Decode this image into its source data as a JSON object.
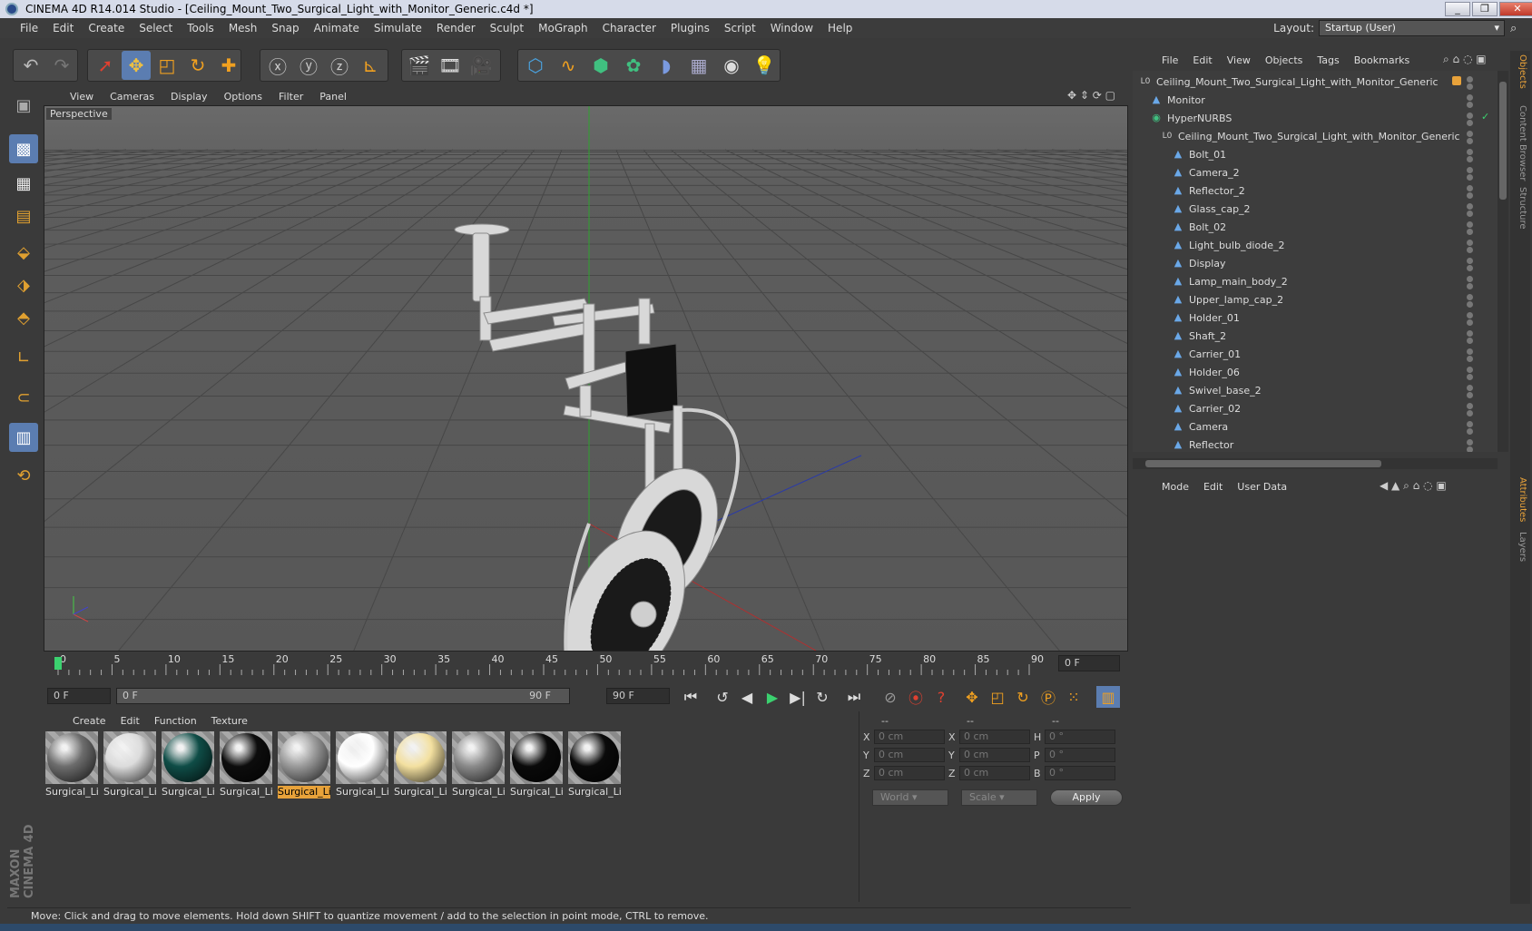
{
  "window": {
    "title": "CINEMA 4D R14.014 Studio - [Ceiling_Mount_Two_Surgical_Light_with_Monitor_Generic.c4d *]"
  },
  "menubar": [
    "File",
    "Edit",
    "Create",
    "Select",
    "Tools",
    "Mesh",
    "Snap",
    "Animate",
    "Simulate",
    "Render",
    "Sculpt",
    "MoGraph",
    "Character",
    "Plugins",
    "Script",
    "Window",
    "Help"
  ],
  "layout": {
    "label": "Layout:",
    "value": "Startup (User)"
  },
  "viewport": {
    "menu": [
      "View",
      "Cameras",
      "Display",
      "Options",
      "Filter",
      "Panel"
    ],
    "label": "Perspective"
  },
  "timeline": {
    "ticks": [
      "0",
      "5",
      "10",
      "15",
      "20",
      "25",
      "30",
      "35",
      "40",
      "45",
      "50",
      "55",
      "60",
      "65",
      "70",
      "75",
      "80",
      "85",
      "90"
    ],
    "current_frame": "0 F",
    "start_field": "0 F",
    "range_start": "0 F",
    "range_end": "90 F",
    "end_field": "90 F"
  },
  "materials": {
    "menu": [
      "Create",
      "Edit",
      "Function",
      "Texture"
    ],
    "items": [
      {
        "label": "Surgical_Li",
        "color": "#6d6d6d",
        "selected": false
      },
      {
        "label": "Surgical_Li",
        "color": "#dcdcdc",
        "selected": false
      },
      {
        "label": "Surgical_Li",
        "color": "#0f4d47",
        "selected": false
      },
      {
        "label": "Surgical_Li",
        "color": "#0d0d0d",
        "selected": false
      },
      {
        "label": "Surgical_Li",
        "color": "#9a9a9a",
        "selected": true
      },
      {
        "label": "Surgical_Li",
        "color": "#ffffff",
        "selected": false
      },
      {
        "label": "Surgical_Li",
        "color": "#f3e0a0",
        "selected": false
      },
      {
        "label": "Surgical_Li",
        "color": "#8a8a8a",
        "selected": false
      },
      {
        "label": "Surgical_Li",
        "color": "#0a0a0a",
        "selected": false
      },
      {
        "label": "Surgical_Li",
        "color": "#0a0a0a",
        "selected": false
      }
    ]
  },
  "coordinates": {
    "headers": [
      "--",
      "--",
      "--"
    ],
    "rows": [
      {
        "a": "X",
        "av": "0 cm",
        "b": "X",
        "bv": "0 cm",
        "c": "H",
        "cv": "0 °"
      },
      {
        "a": "Y",
        "av": "0 cm",
        "b": "Y",
        "bv": "0 cm",
        "c": "P",
        "cv": "0 °"
      },
      {
        "a": "Z",
        "av": "0 cm",
        "b": "Z",
        "bv": "0 cm",
        "c": "B",
        "cv": "0 °"
      }
    ],
    "world": "World",
    "scale": "Scale",
    "apply": "Apply"
  },
  "objects": {
    "menu": [
      "File",
      "Edit",
      "View",
      "Objects",
      "Tags",
      "Bookmarks"
    ],
    "rows": [
      {
        "name": "Ceiling_Mount_Two_Surgical_Light_with_Monitor_Generic",
        "indent": 0,
        "icon": "null-icon"
      },
      {
        "name": "Monitor",
        "indent": 1,
        "icon": "polygon-icon"
      },
      {
        "name": "HyperNURBS",
        "indent": 1,
        "icon": "hypernurbs-icon"
      },
      {
        "name": "Ceiling_Mount_Two_Surgical_Light_with_Monitor_Generic",
        "indent": 2,
        "icon": "null-icon"
      },
      {
        "name": "Bolt_01",
        "indent": 3,
        "icon": "polygon-icon"
      },
      {
        "name": "Camera_2",
        "indent": 3,
        "icon": "polygon-icon"
      },
      {
        "name": "Reflector_2",
        "indent": 3,
        "icon": "polygon-icon"
      },
      {
        "name": "Glass_cap_2",
        "indent": 3,
        "icon": "polygon-icon"
      },
      {
        "name": "Bolt_02",
        "indent": 3,
        "icon": "polygon-icon"
      },
      {
        "name": "Light_bulb_diode_2",
        "indent": 3,
        "icon": "polygon-icon"
      },
      {
        "name": "Display",
        "indent": 3,
        "icon": "polygon-icon"
      },
      {
        "name": "Lamp_main_body_2",
        "indent": 3,
        "icon": "polygon-icon"
      },
      {
        "name": "Upper_lamp_cap_2",
        "indent": 3,
        "icon": "polygon-icon"
      },
      {
        "name": "Holder_01",
        "indent": 3,
        "icon": "polygon-icon"
      },
      {
        "name": "Shaft_2",
        "indent": 3,
        "icon": "polygon-icon"
      },
      {
        "name": "Carrier_01",
        "indent": 3,
        "icon": "polygon-icon"
      },
      {
        "name": "Holder_06",
        "indent": 3,
        "icon": "polygon-icon"
      },
      {
        "name": "Swivel_base_2",
        "indent": 3,
        "icon": "polygon-icon"
      },
      {
        "name": "Carrier_02",
        "indent": 3,
        "icon": "polygon-icon"
      },
      {
        "name": "Camera",
        "indent": 3,
        "icon": "polygon-icon"
      },
      {
        "name": "Reflector",
        "indent": 3,
        "icon": "polygon-icon"
      }
    ]
  },
  "attributes": {
    "menu": [
      "Mode",
      "Edit",
      "User Data"
    ]
  },
  "side_tabs": [
    "Objects",
    "Content Browser",
    "Structure",
    "Attributes",
    "Layers"
  ],
  "status": "Move: Click and drag to move elements. Hold down SHIFT to quantize movement / add to the selection in point mode, CTRL to remove.",
  "brand": "MAXON CINEMA 4D",
  "colors": {
    "accent": "#5b7db1",
    "selection": "#e8a23a",
    "panel": "#3a3a3a"
  }
}
